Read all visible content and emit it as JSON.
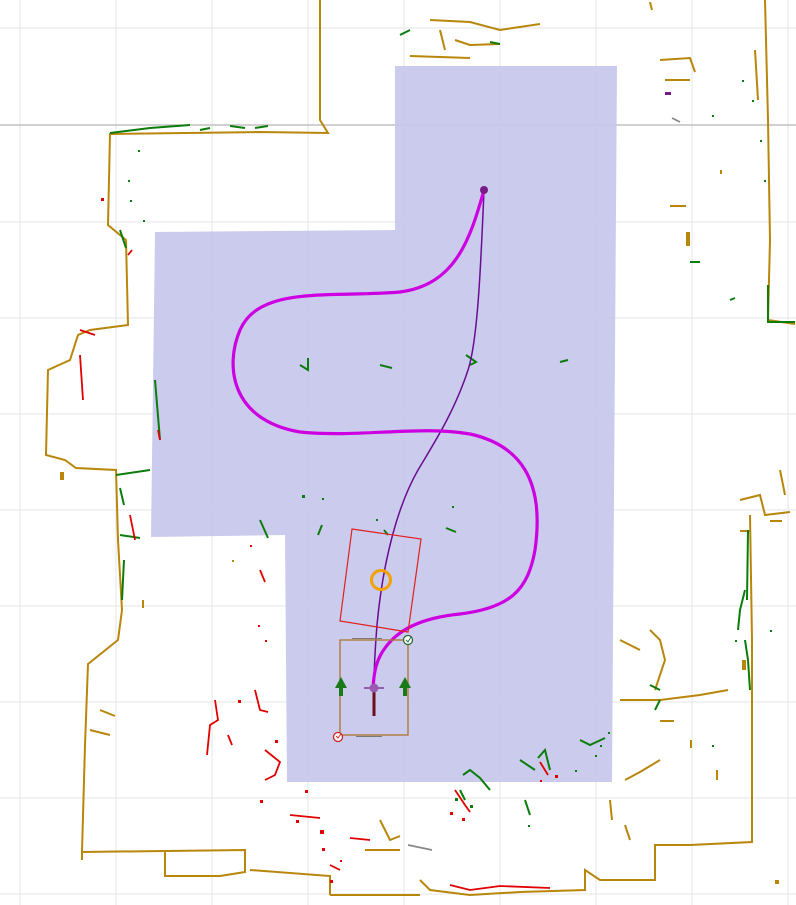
{
  "view": {
    "type": "robot-navigation-map",
    "background": "#ffffff"
  },
  "colors": {
    "grid": "#e6e6e6",
    "axis_line": "#b4b4b4",
    "free_space": "#c8c8ec",
    "wall": "#b8860b",
    "obstacle_green": "#0a7d0a",
    "obstacle_red": "#e00000",
    "planned_path": "#cc00e0",
    "reference_path": "#6a0d91",
    "goal_marker": "#7a1a8a",
    "robot_footprint": "#b07a3a",
    "target_box": "#e02020",
    "target_circle": "#f2a100",
    "arrows": "#1a7a1a",
    "robot_center": "#7a1a8a",
    "heading_line": "#6b0f1a",
    "wheel_marker_green": "#2a6a3a",
    "wheel_marker_red": "#d02020"
  },
  "icons": {
    "goal": "goal-dot-icon",
    "target": "target-circle-icon",
    "left_arrow": "arrow-up-icon",
    "right_arrow": "arrow-up-icon",
    "robot": "robot-footprint-icon"
  }
}
